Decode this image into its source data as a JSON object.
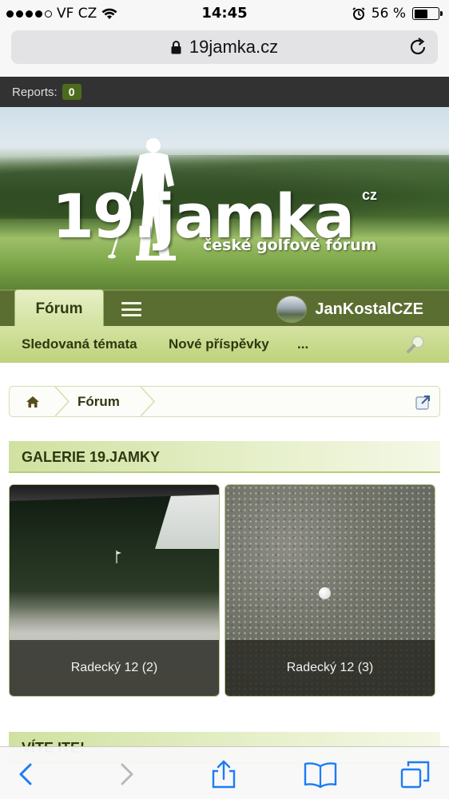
{
  "status_bar": {
    "carrier": "VF CZ",
    "time": "14:45",
    "battery": "56 %",
    "battery_level": 0.56
  },
  "browser": {
    "url": "19jamka.cz"
  },
  "reports": {
    "label": "Reports:",
    "count": "0"
  },
  "banner": {
    "logo": "19.jamka",
    "tld": "cz",
    "tagline": "české golfové fórum"
  },
  "nav": {
    "tab_label": "Fórum",
    "username": "JanKostalCZE"
  },
  "subnav": {
    "items": [
      "Sledovaná témata",
      "Nové příspěvky",
      "..."
    ]
  },
  "breadcrumb": {
    "current": "Fórum"
  },
  "gallery": {
    "heading": "GALERIE 19.JAMKY",
    "items": [
      {
        "caption": "Radecký 12 (2)"
      },
      {
        "caption": "Radecký 12 (3)"
      }
    ]
  },
  "next_section": {
    "heading": "VÍTE ITE!"
  },
  "colors": {
    "nav_dark": "#5b6e31",
    "nav_light": "#d5e3a2",
    "text_dark": "#2d3810",
    "ios_blue": "#1b7cf5"
  }
}
